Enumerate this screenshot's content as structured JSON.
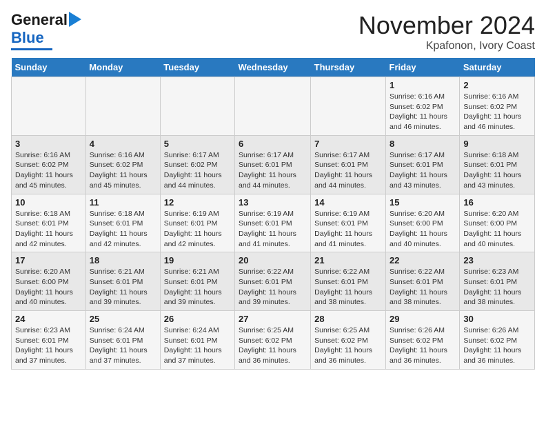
{
  "header": {
    "logo_line1": "General",
    "logo_line2": "Blue",
    "title": "November 2024",
    "subtitle": "Kpafonon, Ivory Coast"
  },
  "days_of_week": [
    "Sunday",
    "Monday",
    "Tuesday",
    "Wednesday",
    "Thursday",
    "Friday",
    "Saturday"
  ],
  "weeks": [
    [
      {
        "day": "",
        "info": ""
      },
      {
        "day": "",
        "info": ""
      },
      {
        "day": "",
        "info": ""
      },
      {
        "day": "",
        "info": ""
      },
      {
        "day": "",
        "info": ""
      },
      {
        "day": "1",
        "info": "Sunrise: 6:16 AM\nSunset: 6:02 PM\nDaylight: 11 hours and 46 minutes."
      },
      {
        "day": "2",
        "info": "Sunrise: 6:16 AM\nSunset: 6:02 PM\nDaylight: 11 hours and 46 minutes."
      }
    ],
    [
      {
        "day": "3",
        "info": "Sunrise: 6:16 AM\nSunset: 6:02 PM\nDaylight: 11 hours and 45 minutes."
      },
      {
        "day": "4",
        "info": "Sunrise: 6:16 AM\nSunset: 6:02 PM\nDaylight: 11 hours and 45 minutes."
      },
      {
        "day": "5",
        "info": "Sunrise: 6:17 AM\nSunset: 6:02 PM\nDaylight: 11 hours and 44 minutes."
      },
      {
        "day": "6",
        "info": "Sunrise: 6:17 AM\nSunset: 6:01 PM\nDaylight: 11 hours and 44 minutes."
      },
      {
        "day": "7",
        "info": "Sunrise: 6:17 AM\nSunset: 6:01 PM\nDaylight: 11 hours and 44 minutes."
      },
      {
        "day": "8",
        "info": "Sunrise: 6:17 AM\nSunset: 6:01 PM\nDaylight: 11 hours and 43 minutes."
      },
      {
        "day": "9",
        "info": "Sunrise: 6:18 AM\nSunset: 6:01 PM\nDaylight: 11 hours and 43 minutes."
      }
    ],
    [
      {
        "day": "10",
        "info": "Sunrise: 6:18 AM\nSunset: 6:01 PM\nDaylight: 11 hours and 42 minutes."
      },
      {
        "day": "11",
        "info": "Sunrise: 6:18 AM\nSunset: 6:01 PM\nDaylight: 11 hours and 42 minutes."
      },
      {
        "day": "12",
        "info": "Sunrise: 6:19 AM\nSunset: 6:01 PM\nDaylight: 11 hours and 42 minutes."
      },
      {
        "day": "13",
        "info": "Sunrise: 6:19 AM\nSunset: 6:01 PM\nDaylight: 11 hours and 41 minutes."
      },
      {
        "day": "14",
        "info": "Sunrise: 6:19 AM\nSunset: 6:01 PM\nDaylight: 11 hours and 41 minutes."
      },
      {
        "day": "15",
        "info": "Sunrise: 6:20 AM\nSunset: 6:00 PM\nDaylight: 11 hours and 40 minutes."
      },
      {
        "day": "16",
        "info": "Sunrise: 6:20 AM\nSunset: 6:00 PM\nDaylight: 11 hours and 40 minutes."
      }
    ],
    [
      {
        "day": "17",
        "info": "Sunrise: 6:20 AM\nSunset: 6:00 PM\nDaylight: 11 hours and 40 minutes."
      },
      {
        "day": "18",
        "info": "Sunrise: 6:21 AM\nSunset: 6:01 PM\nDaylight: 11 hours and 39 minutes."
      },
      {
        "day": "19",
        "info": "Sunrise: 6:21 AM\nSunset: 6:01 PM\nDaylight: 11 hours and 39 minutes."
      },
      {
        "day": "20",
        "info": "Sunrise: 6:22 AM\nSunset: 6:01 PM\nDaylight: 11 hours and 39 minutes."
      },
      {
        "day": "21",
        "info": "Sunrise: 6:22 AM\nSunset: 6:01 PM\nDaylight: 11 hours and 38 minutes."
      },
      {
        "day": "22",
        "info": "Sunrise: 6:22 AM\nSunset: 6:01 PM\nDaylight: 11 hours and 38 minutes."
      },
      {
        "day": "23",
        "info": "Sunrise: 6:23 AM\nSunset: 6:01 PM\nDaylight: 11 hours and 38 minutes."
      }
    ],
    [
      {
        "day": "24",
        "info": "Sunrise: 6:23 AM\nSunset: 6:01 PM\nDaylight: 11 hours and 37 minutes."
      },
      {
        "day": "25",
        "info": "Sunrise: 6:24 AM\nSunset: 6:01 PM\nDaylight: 11 hours and 37 minutes."
      },
      {
        "day": "26",
        "info": "Sunrise: 6:24 AM\nSunset: 6:01 PM\nDaylight: 11 hours and 37 minutes."
      },
      {
        "day": "27",
        "info": "Sunrise: 6:25 AM\nSunset: 6:02 PM\nDaylight: 11 hours and 36 minutes."
      },
      {
        "day": "28",
        "info": "Sunrise: 6:25 AM\nSunset: 6:02 PM\nDaylight: 11 hours and 36 minutes."
      },
      {
        "day": "29",
        "info": "Sunrise: 6:26 AM\nSunset: 6:02 PM\nDaylight: 11 hours and 36 minutes."
      },
      {
        "day": "30",
        "info": "Sunrise: 6:26 AM\nSunset: 6:02 PM\nDaylight: 11 hours and 36 minutes."
      }
    ]
  ]
}
